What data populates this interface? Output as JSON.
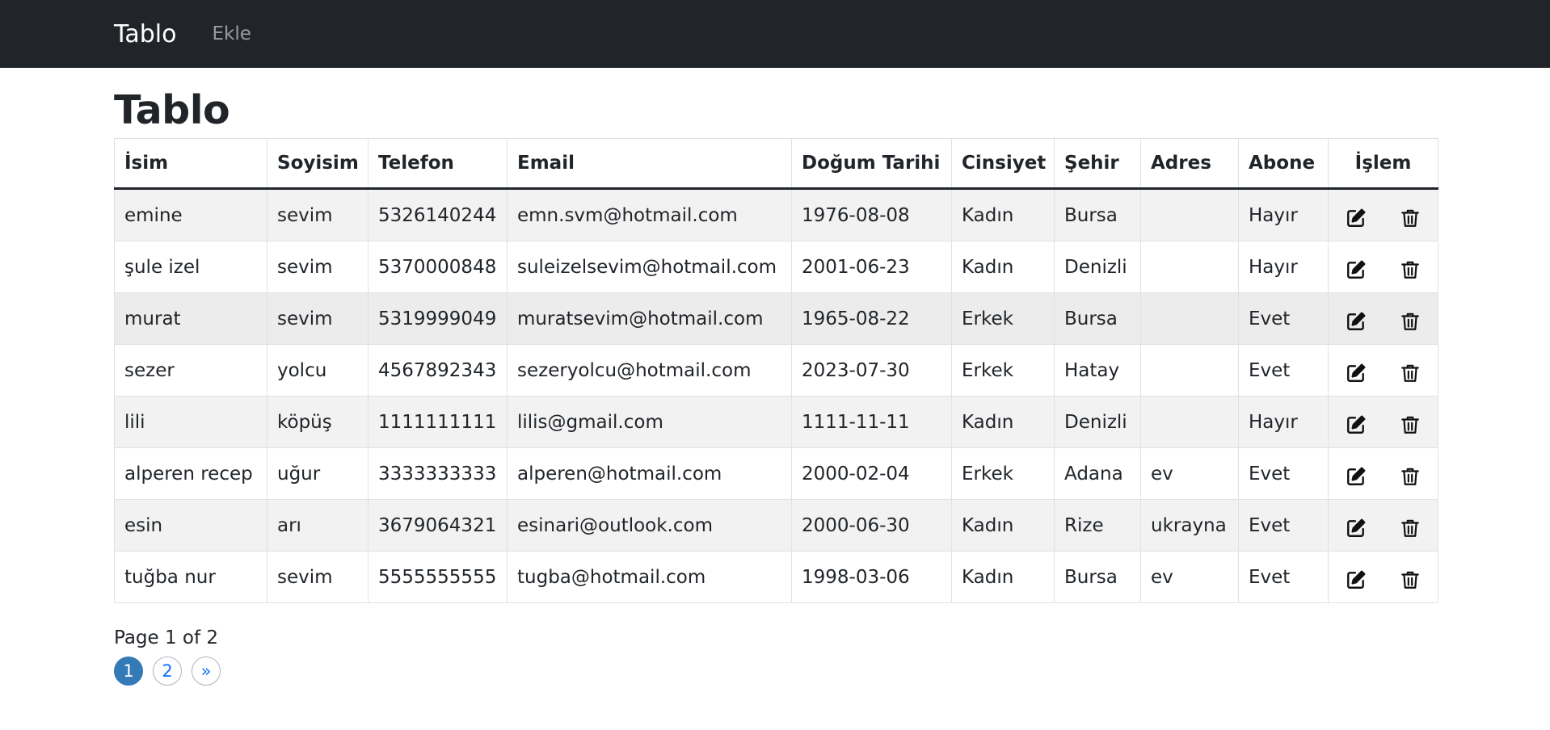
{
  "navbar": {
    "brand": "Tablo",
    "add_link": "Ekle"
  },
  "page": {
    "title": "Tablo"
  },
  "table": {
    "headers": [
      "İsim",
      "Soyisim",
      "Telefon",
      "Email",
      "Doğum Tarihi",
      "Cinsiyet",
      "Şehir",
      "Adres",
      "Abone",
      "İşlem"
    ],
    "rows": [
      [
        "emine",
        "sevim",
        "5326140244",
        "emn.svm@hotmail.com",
        "1976-08-08",
        "Kadın",
        "Bursa",
        "",
        "Hayır"
      ],
      [
        "şule izel",
        "sevim",
        "5370000848",
        "suleizelsevim@hotmail.com",
        "2001-06-23",
        "Kadın",
        "Denizli",
        "",
        "Hayır"
      ],
      [
        "murat",
        "sevim",
        "5319999049",
        "muratsevim@hotmail.com",
        "1965-08-22",
        "Erkek",
        "Bursa",
        "",
        "Evet"
      ],
      [
        "sezer",
        "yolcu",
        "4567892343",
        "sezeryolcu@hotmail.com",
        "2023-07-30",
        "Erkek",
        "Hatay",
        "",
        "Evet"
      ],
      [
        "lili",
        "köpüş",
        "1111111111",
        "lilis@gmail.com",
        "1111-11-11",
        "Kadın",
        "Denizli",
        "",
        "Hayır"
      ],
      [
        "alperen recep",
        "uğur",
        "3333333333",
        "alperen@hotmail.com",
        "2000-02-04",
        "Erkek",
        "Adana",
        "ev",
        "Evet"
      ],
      [
        "esin",
        "arı",
        "3679064321",
        "esinari@outlook.com",
        "2000-06-30",
        "Kadın",
        "Rize",
        "ukrayna",
        "Evet"
      ],
      [
        "tuğba nur",
        "sevim",
        "5555555555",
        "tugba@hotmail.com",
        "1998-03-06",
        "Kadın",
        "Bursa",
        "ev",
        "Evet"
      ]
    ],
    "action_icons": [
      "edit-icon",
      "trash-icon"
    ]
  },
  "pagination": {
    "label": "Page 1 of 2",
    "pages": [
      "1",
      "2",
      "»"
    ],
    "active_page": "1",
    "active_color": "#337ab7",
    "link_color": "#0d6efd"
  },
  "colors": {
    "navbar_bg": "#212529",
    "stripe": "#f2f2f2"
  }
}
